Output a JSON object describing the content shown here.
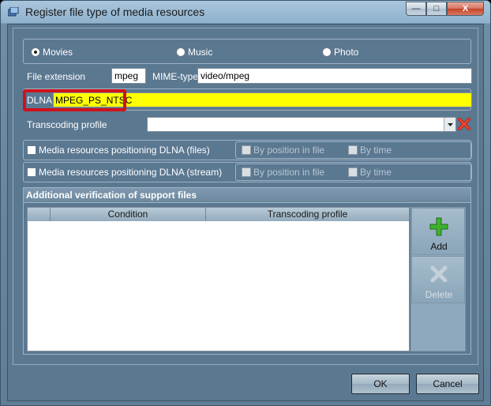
{
  "window": {
    "title": "Register file type of media resources",
    "minimize": "—",
    "maximize": "□",
    "close": "X"
  },
  "media_type": {
    "options": [
      {
        "label": "Movies",
        "selected": true
      },
      {
        "label": "Music",
        "selected": false
      },
      {
        "label": "Photo",
        "selected": false
      }
    ]
  },
  "file_extension": {
    "label": "File extension",
    "value": "mpeg"
  },
  "mime_type": {
    "label": "MIME-type",
    "value": "video/mpeg"
  },
  "dlna": {
    "label": "DLNA",
    "value": "MPEG_PS_NTSC",
    "highlight_color": "#ffff00",
    "callout_color": "#d0111b"
  },
  "transcoding": {
    "label": "Transcoding profile",
    "value": ""
  },
  "positioning_files": {
    "label": "Media resources positioning DLNA (files)",
    "by_position": "By position in file",
    "by_time": "By time"
  },
  "positioning_stream": {
    "label": "Media resources positioning DLNA  (stream)",
    "by_position": "By position in file",
    "by_time": "By time"
  },
  "verification": {
    "title": "Additional verification of support files",
    "columns": [
      "",
      "Condition",
      "Transcoding profile"
    ],
    "rows": [],
    "add_label": "Add",
    "delete_label": "Delete"
  },
  "buttons": {
    "ok": "OK",
    "cancel": "Cancel"
  }
}
